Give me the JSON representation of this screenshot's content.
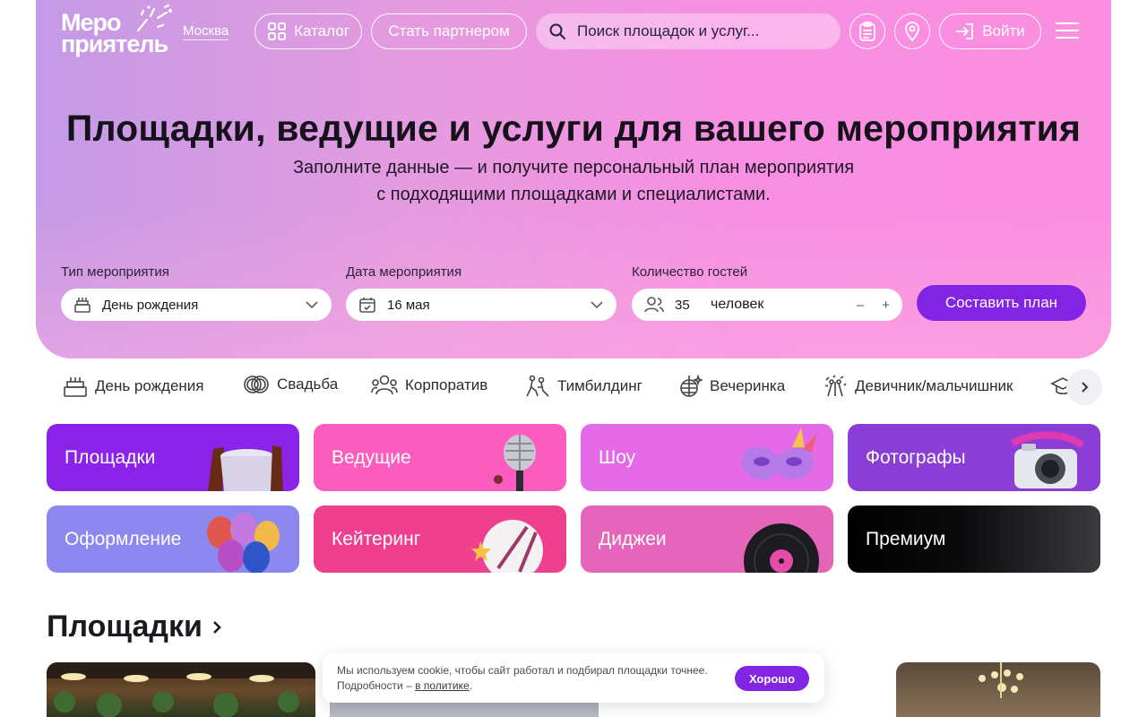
{
  "header": {
    "logo_line1": "Меро",
    "logo_line2": "приятель",
    "city": "Москва",
    "catalog_label": "Каталог",
    "partner_label": "Стать партнером",
    "search_placeholder": "Поиск площадок и услуг...",
    "login_label": "Войти"
  },
  "hero": {
    "title": "Площадки, ведущие и услуги для вашего мероприятия",
    "subtitle_line1": "Заполните данные — и получите персональный план мероприятия",
    "subtitle_line2": "с подходящими площадками и специалистами."
  },
  "form": {
    "event_type_label": "Тип мероприятия",
    "event_type_value": "День рождения",
    "date_label": "Дата мероприятия",
    "date_value": "16 мая",
    "guests_label": "Количество гостей",
    "guests_value": "35",
    "guests_unit": "человек",
    "minus": "–",
    "plus": "+",
    "submit_label": "Составить план"
  },
  "event_categories": [
    {
      "label": "День рождения",
      "icon": "cake-icon"
    },
    {
      "label": "Свадьба",
      "icon": "rings-icon"
    },
    {
      "label": "Корпоратив",
      "icon": "people-icon"
    },
    {
      "label": "Тимбилдинг",
      "icon": "teambuilding-icon"
    },
    {
      "label": "Вечеринка",
      "icon": "disco-ball-icon"
    },
    {
      "label": "Девичник/мальчишник",
      "icon": "party-icon"
    }
  ],
  "service_tiles": [
    {
      "label": "Площадки",
      "color": "#8b24e8"
    },
    {
      "label": "Ведущие",
      "color": "#fd5cbf"
    },
    {
      "label": "Шоу",
      "color": "#e46ae7"
    },
    {
      "label": "Фотографы",
      "color": "#8a3ed6"
    },
    {
      "label": "Оформление",
      "color": "#8d87f0"
    },
    {
      "label": "Кейтеринг",
      "color": "#ef4090"
    },
    {
      "label": "Диджеи",
      "color": "#e565ba"
    },
    {
      "label": "Премиум",
      "color": "#111111"
    }
  ],
  "section": {
    "venues_title": "Площадки"
  },
  "cookie": {
    "text": "Мы используем cookie, чтобы сайт работал и подбирал площадки точнее. Подробности –",
    "link": "в политике",
    "end": ".",
    "ok_label": "Хорошо"
  },
  "colors": {
    "accent": "#8224e3",
    "hero_start": "#c49ae6",
    "hero_end": "#fb8fe0"
  }
}
